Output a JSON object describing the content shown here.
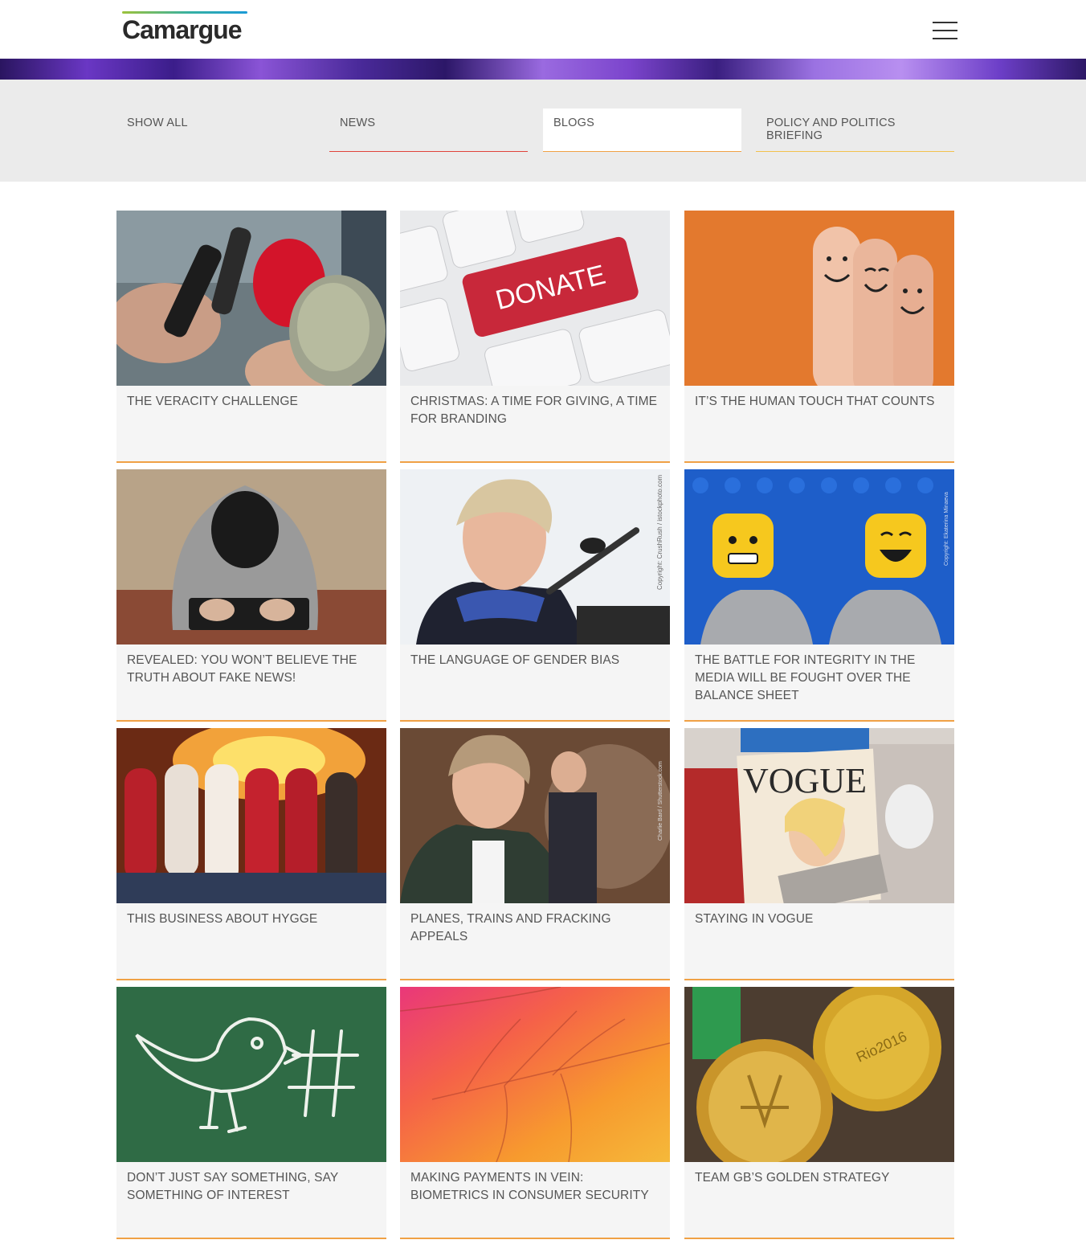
{
  "header": {
    "logo_text": "Camargue",
    "menu_icon": "hamburger-menu-icon"
  },
  "filters": [
    {
      "label": "SHOW ALL"
    },
    {
      "label": "NEWS"
    },
    {
      "label": "BLOGS"
    },
    {
      "label": "POLICY AND POLITICS BRIEFING"
    }
  ],
  "colors": {
    "card_underline": "#f0a145",
    "news_underline": "#e0433a",
    "policy_underline": "#f3c14d",
    "filter_bg": "#ebebeb"
  },
  "posts": [
    {
      "title": "THE VERACITY CHALLENGE",
      "image": "press-microphones-image"
    },
    {
      "title": "CHRISTMAS: A TIME FOR GIVING, A TIME FOR BRANDING",
      "image": "donate-keyboard-image",
      "image_text": "DONATE"
    },
    {
      "title": "IT’S THE HUMAN TOUCH THAT COUNTS",
      "image": "smiley-fingers-image"
    },
    {
      "title": "REVEALED: YOU WON’T BELIEVE THE TRUTH ABOUT FAKE NEWS!",
      "image": "hooded-hacker-image"
    },
    {
      "title": "THE LANGUAGE OF GENDER BIAS",
      "image": "speaker-at-podium-image",
      "image_credit": "Copyright: CrushRush / istockphoto.com"
    },
    {
      "title": "THE BATTLE FOR INTEGRITY IN THE MEDIA WILL BE FOUGHT OVER THE BALANCE SHEET",
      "image": "lego-faces-image",
      "image_credit": "Copyright: Ekaterina Minaeva"
    },
    {
      "title": "THIS BUSINESS ABOUT HYGGE",
      "image": "socks-by-fire-image"
    },
    {
      "title": "PLANES, TRAINS AND FRACKING APPEALS",
      "image": "politician-speaking-image",
      "image_credit": "Charlie Bard / Shutterstock.com"
    },
    {
      "title": "STAYING IN VOGUE",
      "image": "vogue-magazines-image",
      "image_text": "VOGUE"
    },
    {
      "title": "DON’T JUST SAY SOMETHING, SAY SOMETHING OF INTEREST",
      "image": "chalk-bird-hashtag-image"
    },
    {
      "title": "MAKING PAYMENTS IN VEIN: BIOMETRICS IN CONSUMER SECURITY",
      "image": "leaf-veins-image"
    },
    {
      "title": "TEAM GB’S GOLDEN STRATEGY",
      "image": "gold-medals-image",
      "image_text": "Rio2016"
    }
  ]
}
